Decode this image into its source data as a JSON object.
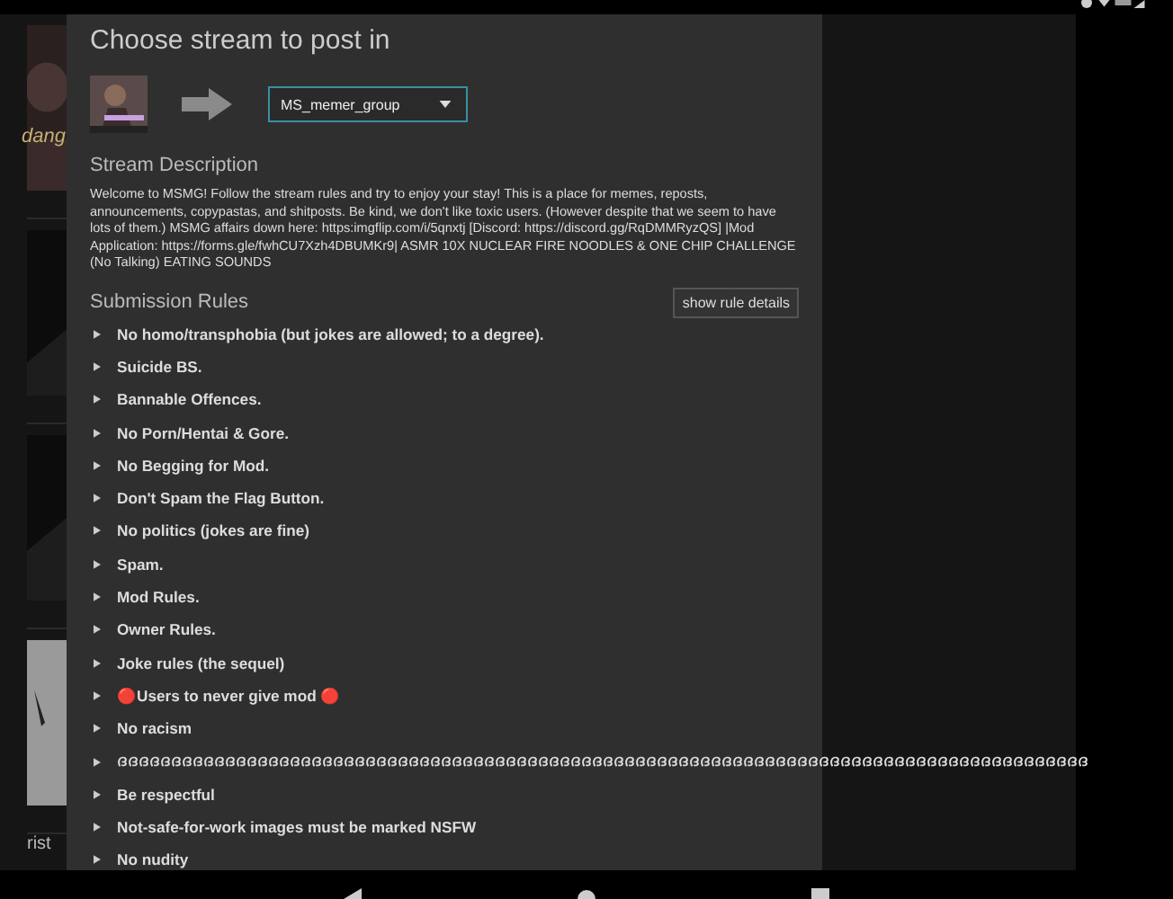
{
  "background": {
    "fragments": [
      "dang",
      "rist"
    ]
  },
  "dialog": {
    "title": "Choose stream to post in",
    "stream_select": {
      "value": "MS_memer_group"
    },
    "description_heading": "Stream Description",
    "description": "Welcome to MSMG! Follow the stream rules and try to enjoy your stay! This is a place for memes, reposts, announcements, copypastas, and shitposts. Be kind, we don't like toxic users. (However despite that we seem to have lots of them.) MSMG affairs down here: https:imgflip.com/i/5qnxtj [Discord: https://discord.gg/RqDMMRyzQS] |Mod Application: https://forms.gle/fwhCU7Xzh4DBUMKr9| ASMR 10X NUCLEAR FIRE NOODLES & ONE CHIP CHALLENGE (No Talking) EATING SOUNDS",
    "rules_heading": "Submission Rules",
    "rule_details_button": "show rule details",
    "rules": [
      {
        "text": "No homo/transphobia (but jokes are allowed; to a degree).",
        "expanded": false
      },
      {
        "text": "Suicide BS.",
        "expanded": false
      },
      {
        "text": "Bannable Offences.",
        "expanded": false
      },
      {
        "text": "No Porn/Hentai & Gore.",
        "expanded": false
      },
      {
        "text": "No Begging for Mod.",
        "expanded": false
      },
      {
        "text": "Don't Spam the Flag Button.",
        "expanded": false
      },
      {
        "text": "No politics (jokes are fine)",
        "expanded": false
      },
      {
        "text": "Spam.",
        "expanded": false
      },
      {
        "text": "Mod Rules.",
        "expanded": false
      },
      {
        "text": "Owner Rules.",
        "expanded": false
      },
      {
        "text": "Joke rules (the sequel)",
        "expanded": false
      },
      {
        "text": "🔴Users to never give mod 🔴",
        "expanded": false
      },
      {
        "text": "No racism",
        "expanded": false
      },
      {
        "text": "ദദദദദദദദദദദദദദദദദദദദദദദദദദദദദദദദദദദദദദദദദദദദദദദദദദദദദദദദദദദദദദദദദദദദദദദദദദദദദദദദദദദദദദദദദദ",
        "expanded": false
      },
      {
        "text": "Be respectful",
        "expanded": false
      },
      {
        "text": "Not-safe-for-work images must be marked NSFW",
        "expanded": false
      },
      {
        "text": "No nudity",
        "expanded": false
      }
    ]
  }
}
